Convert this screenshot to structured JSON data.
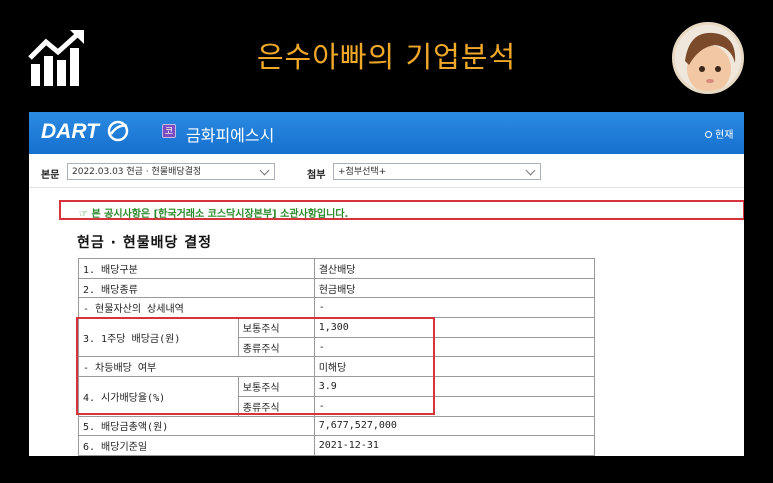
{
  "banner": {
    "title": "은수아빠의 기업분석"
  },
  "dart": {
    "logo": "DART",
    "corp_badge": "코",
    "corp_name": "금화피에스시",
    "now_label": "현재"
  },
  "toolbar": {
    "report_label": "본문",
    "report_value": "2022.03.03  현금 · 현물배당결정",
    "attach_label": "첨부",
    "attach_value": "+첨부선택+"
  },
  "notice": "☞ 본 공시사항은 [한국거래소 코스닥시장본부] 소관사항입니다.",
  "doc_title": "현금 · 현물배당 결정",
  "rows": [
    {
      "label": "1. 배당구분",
      "value": "결산배당"
    },
    {
      "label": "2. 배당종류",
      "value": "현금배당"
    },
    {
      "label": "- 현물자산의 상세내역",
      "value": "-"
    },
    {
      "label": "3. 1주당 배당금(원)",
      "sub": [
        {
          "type": "보통주식",
          "value": "1,300"
        },
        {
          "type": "종류주식",
          "value": "-"
        }
      ]
    },
    {
      "label": "- 차등배당 여부",
      "value": "미해당"
    },
    {
      "label": "4. 시가배당율(%)",
      "sub": [
        {
          "type": "보통주식",
          "value": "3.9"
        },
        {
          "type": "종류주식",
          "value": "-"
        }
      ]
    },
    {
      "label": "5. 배당금총액(원)",
      "value": "7,677,527,000"
    },
    {
      "label": "6. 배당기준일",
      "value": "2021-12-31"
    }
  ],
  "colors": {
    "banner_title": "#f0a829",
    "dart_header": "#1f7fdc",
    "highlight": "#d7333a",
    "notice_text": "#2d8a2d"
  },
  "icons": {
    "logo": "growth-chart-icon",
    "avatar": "child-photo"
  }
}
